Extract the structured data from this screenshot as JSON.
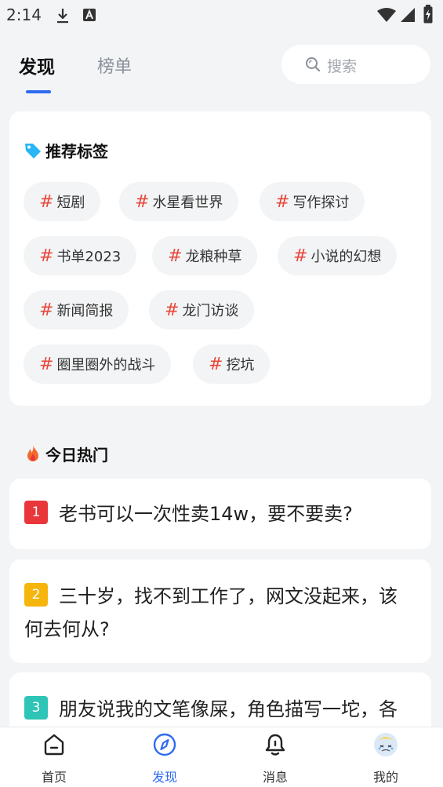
{
  "status_bar": {
    "time": "2:14",
    "icons": [
      "download-icon",
      "a-icon",
      "wifi-icon",
      "signal-icon",
      "battery-icon"
    ]
  },
  "header": {
    "tabs": [
      {
        "label": "发现",
        "active": true
      },
      {
        "label": "榜单",
        "active": false
      }
    ],
    "search": {
      "placeholder": "搜索",
      "icon": "search-icon"
    }
  },
  "recommended_tags": {
    "title": "推荐标签",
    "icon": "tag-icon",
    "hash_symbol": "#",
    "tags": [
      "短剧",
      "水星看世界",
      "写作探讨",
      "书单2023",
      "龙粮种草",
      "小说的幻想",
      "新闻简报",
      "龙门访谈",
      "圈里圈外的战斗",
      "挖坑"
    ]
  },
  "hot_today": {
    "title": "今日热门",
    "icon": "fire-icon",
    "items": [
      {
        "rank": "1",
        "text": "老书可以一次性卖14w，要不要卖?",
        "badge_color": "#e8363b"
      },
      {
        "rank": "2",
        "text": "三十岁，找不到工作了，网文没起来，该何去何从?",
        "badge_color": "#f5b50d"
      },
      {
        "rank": "3",
        "text": "朋友说我的文笔像屎，角色描写一坨，各",
        "badge_color": "#2ec4b6"
      }
    ]
  },
  "bottom_nav": {
    "items": [
      {
        "label": "首页",
        "icon": "home-icon",
        "active": false
      },
      {
        "label": "发现",
        "icon": "compass-icon",
        "active": true
      },
      {
        "label": "消息",
        "icon": "bell-icon",
        "active": false
      },
      {
        "label": "我的",
        "icon": "avatar-icon",
        "active": false
      }
    ]
  },
  "colors": {
    "accent": "#2d6bf0",
    "hash": "#e8483b",
    "background": "#f3f4f6"
  }
}
